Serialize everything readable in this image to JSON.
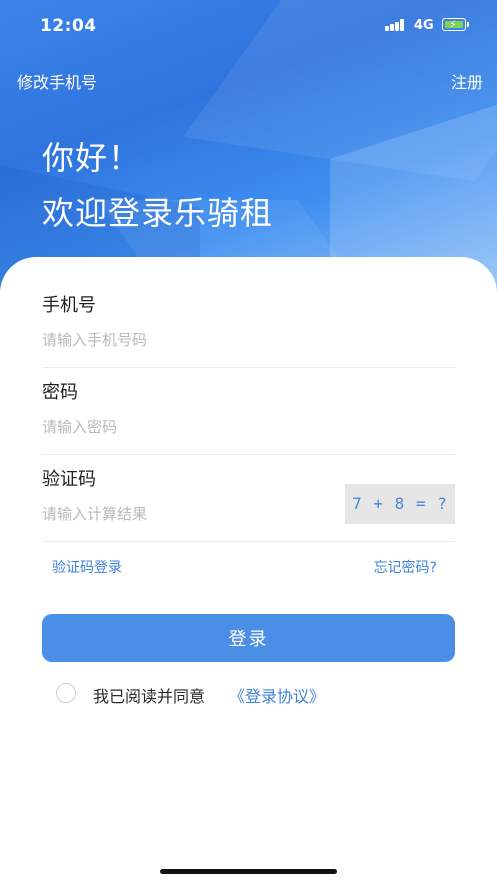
{
  "status_bar": {
    "time": "12:04",
    "network": "4G",
    "battery_fill_fraction": 0.8,
    "battery_color": "#7bd35a",
    "charging": true
  },
  "nav": {
    "left_label": "修改手机号",
    "right_label": "注册"
  },
  "hero": {
    "greeting": "你好！",
    "welcome": "欢迎登录乐骑租",
    "background_color": "#3c83ea"
  },
  "form": {
    "phone": {
      "label": "手机号",
      "placeholder": "请输入手机号码",
      "value": ""
    },
    "password": {
      "label": "密码",
      "placeholder": "请输入密码",
      "value": ""
    },
    "captcha": {
      "label": "验证码",
      "placeholder": "请输入计算结果",
      "value": "",
      "challenge": "7 + 8 = ?"
    }
  },
  "links": {
    "sms_login": "验证码登录",
    "forgot_password": "忘记密码?"
  },
  "login_button": {
    "label": "登录",
    "color": "#4a8ee6"
  },
  "agreement": {
    "checked": false,
    "text": "我已阅读并同意",
    "link": "《登录协议》",
    "link_color": "#3f82dd"
  },
  "icons": {
    "signal": "signal-bars-icon",
    "battery": "battery-charging-icon",
    "checkbox": "radio-circle-icon"
  }
}
